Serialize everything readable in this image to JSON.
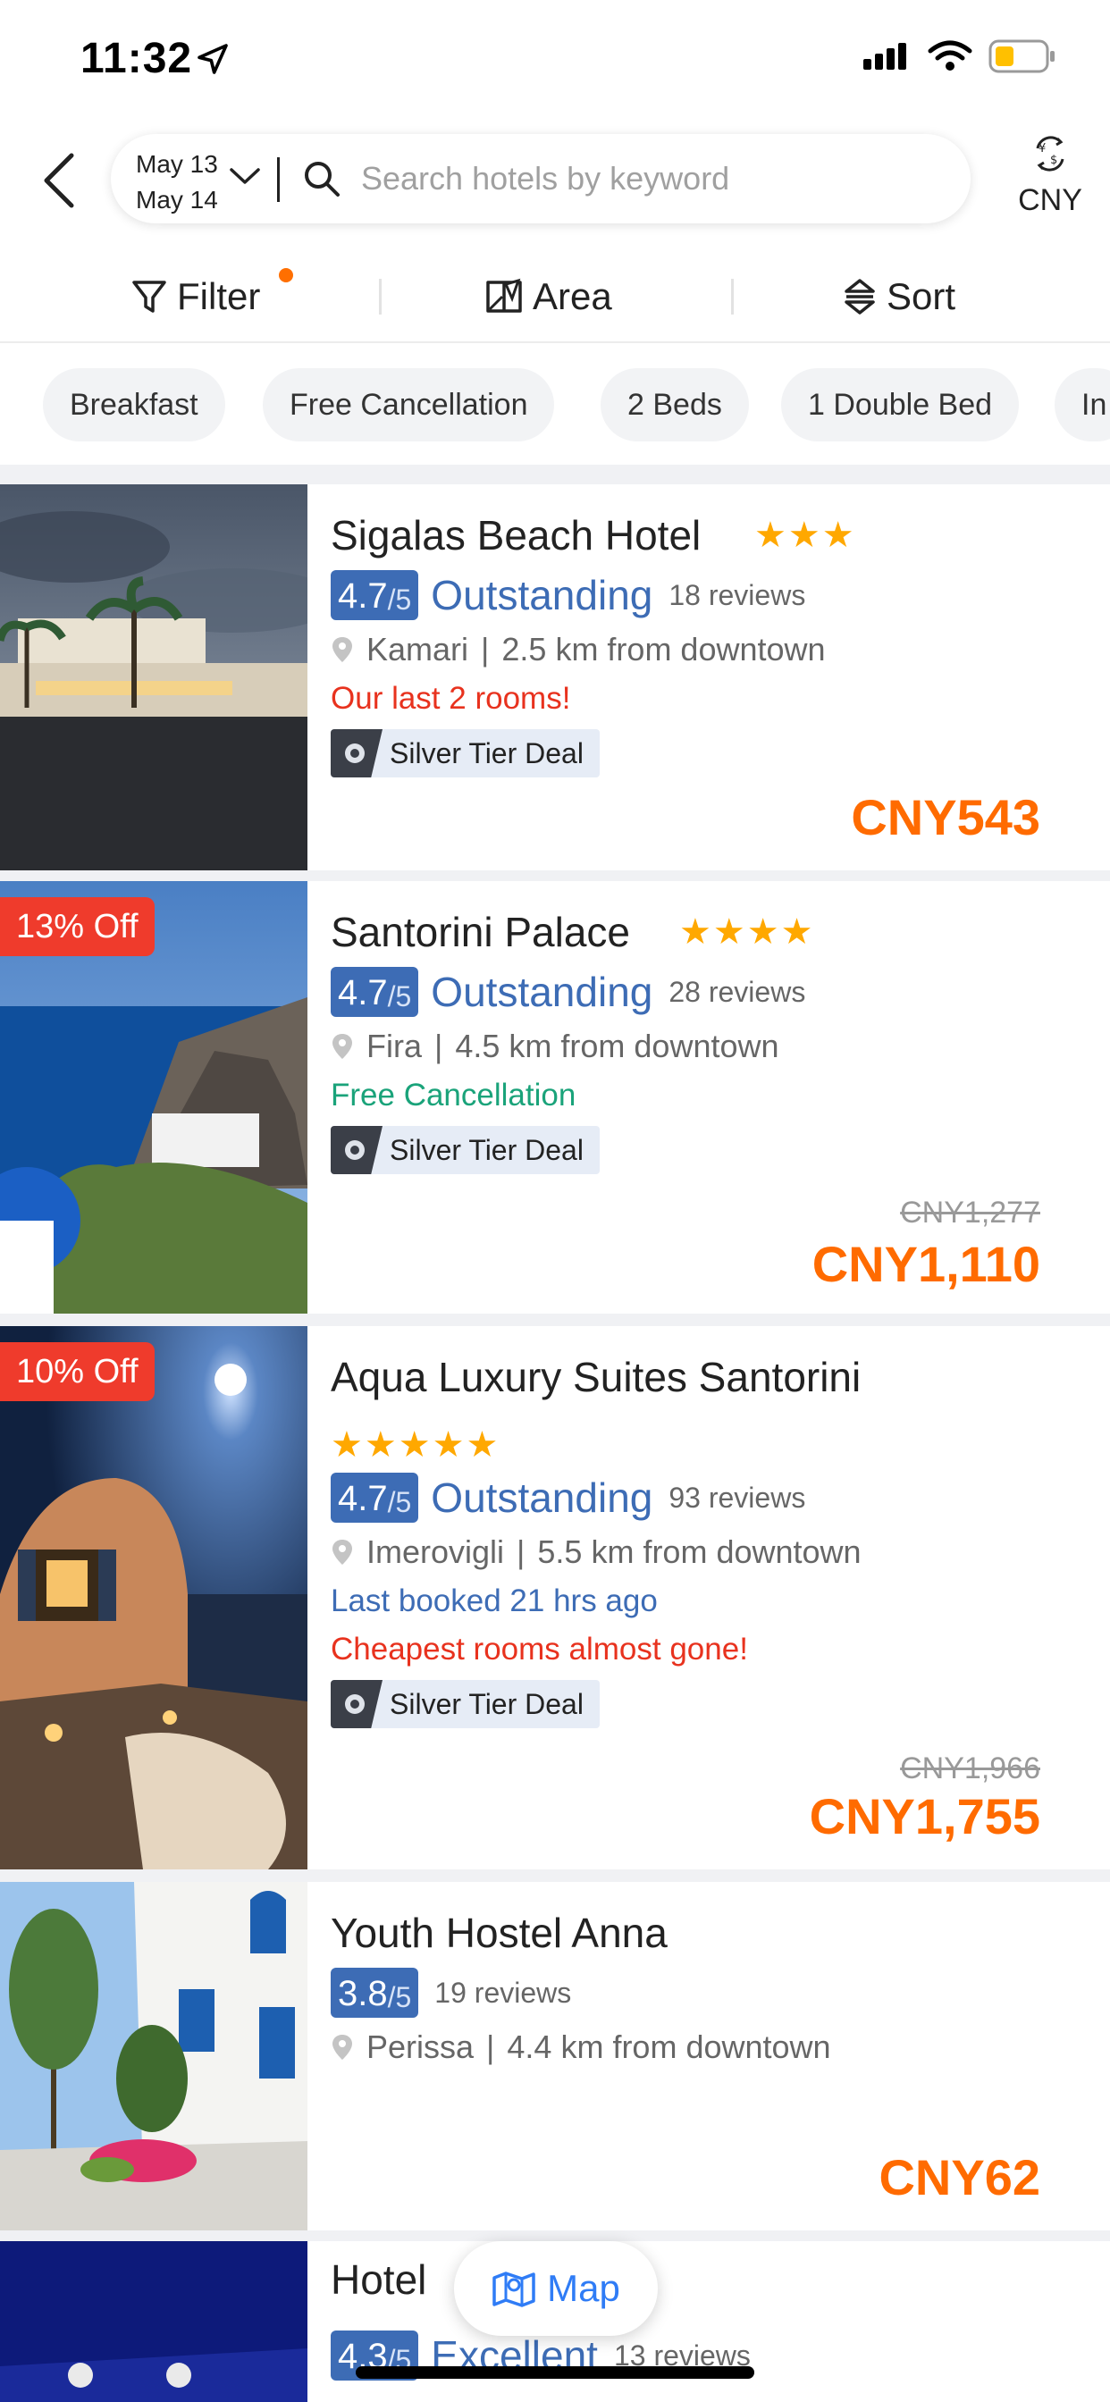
{
  "status_bar": {
    "time": "11:32"
  },
  "nav": {
    "checkin": "May 13",
    "checkout": "May 14",
    "search_placeholder": "Search hotels by keyword",
    "currency": "CNY"
  },
  "filters": {
    "filter": "Filter",
    "area": "Area",
    "sort": "Sort"
  },
  "chips": [
    "Breakfast",
    "Free Cancellation",
    "2 Beds",
    "1 Double Bed",
    "In"
  ],
  "hotels": [
    {
      "name": "Sigalas Beach Hotel",
      "stars": "★★★",
      "score": "4.7",
      "score_max": "/5",
      "rating_word": "Outstanding",
      "reviews": "18 reviews",
      "area": "Kamari",
      "distance": "2.5 km from downtown",
      "notes": [
        "Our last 2 rooms!"
      ],
      "deal": "Silver Tier Deal",
      "price": "CNY543"
    },
    {
      "name": "Santorini Palace",
      "stars": "★★★★",
      "discount": "13% Off",
      "score": "4.7",
      "score_max": "/5",
      "rating_word": "Outstanding",
      "reviews": "28 reviews",
      "area": "Fira",
      "distance": "4.5 km from downtown",
      "notes": [
        "Free Cancellation"
      ],
      "deal": "Silver Tier Deal",
      "original_price": "CNY1,277",
      "price": "CNY1,110"
    },
    {
      "name": "Aqua Luxury Suites Santorini",
      "stars": "★★★★★",
      "discount": "10% Off",
      "score": "4.7",
      "score_max": "/5",
      "rating_word": "Outstanding",
      "reviews": "93 reviews",
      "area": "Imerovigli",
      "distance": "5.5 km from downtown",
      "notes": [
        "Last booked 21 hrs ago",
        "Cheapest rooms almost gone!"
      ],
      "deal": "Silver Tier Deal",
      "original_price": "CNY1,966",
      "price": "CNY1,755"
    },
    {
      "name": "Youth Hostel Anna",
      "score": "3.8",
      "score_max": "/5",
      "reviews": "19 reviews",
      "area": "Perissa",
      "distance": "4.4 km from downtown",
      "price": "CNY62"
    },
    {
      "name": "Hotel",
      "score": "4.3",
      "score_max": "/5",
      "rating_word": "Excellent",
      "reviews": "13 reviews"
    }
  ],
  "map_button": "Map",
  "colors": {
    "accent_blue": "#3d6cb5",
    "price_orange": "#ff6b00",
    "alert_red": "#e8321e",
    "green": "#1aa37a",
    "link_blue": "#3d6cb5",
    "star": "#ffa800"
  },
  "icons": [
    "location-arrow-icon",
    "signal-icon",
    "wifi-icon",
    "battery-icon",
    "back-icon",
    "chevron-down-icon",
    "search-icon",
    "currency-icon",
    "filter-icon",
    "area-map-icon",
    "sort-icon",
    "pin-icon",
    "deal-badge-icon",
    "map-icon"
  ]
}
